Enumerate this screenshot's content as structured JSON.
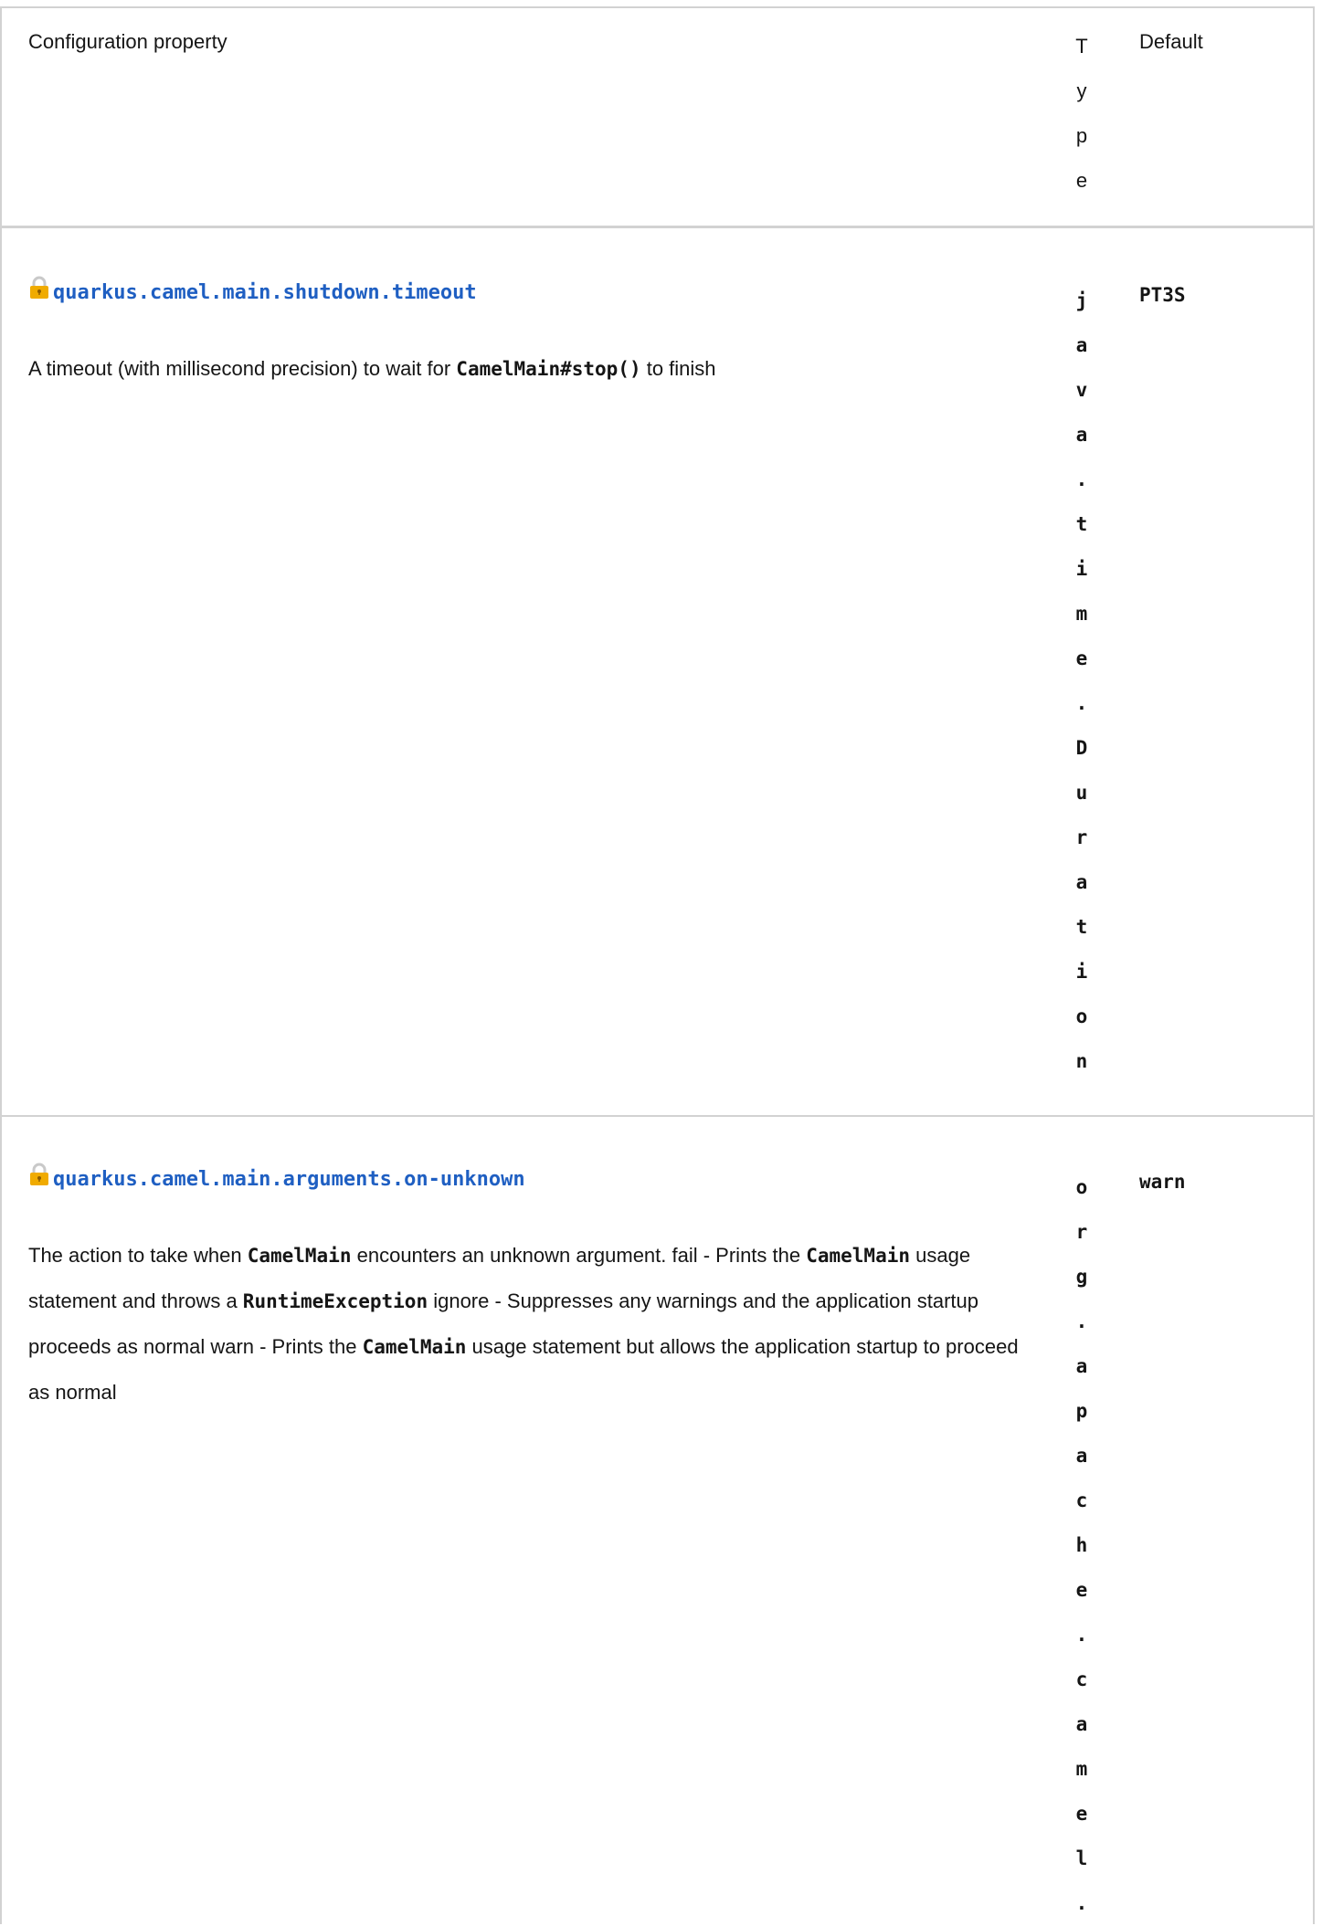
{
  "header": {
    "col_property": "Configuration property",
    "col_type_letters": [
      "T",
      "y",
      "p",
      "e"
    ],
    "col_default": "Default"
  },
  "rows": [
    {
      "name": "quarkus.camel.main.shutdown.timeout",
      "desc": {
        "t1": "A timeout (with millisecond precision) to wait for ",
        "c1": "CamelMain#stop()",
        "t2": " to finish"
      },
      "type_letters": [
        "j",
        "a",
        "v",
        "a",
        ".",
        "t",
        "i",
        "m",
        "e",
        ".",
        "D",
        "u",
        "r",
        "a",
        "t",
        "i",
        "o",
        "n"
      ],
      "default": "PT3S",
      "icon": "lock-icon"
    },
    {
      "name": "quarkus.camel.main.arguments.on-unknown",
      "desc": {
        "t1": "The action to take when ",
        "c1": "CamelMain",
        "t2": " encounters an unknown argument. fail - Prints the ",
        "c2": "CamelMain",
        "t3": " usage statement and throws a ",
        "c3": "RuntimeException",
        "t4": " ignore - Suppresses any warnings and the application startup proceeds as normal warn - Prints the ",
        "c4": "CamelMain",
        "t5": " usage statement but allows the application startup to proceed as normal"
      },
      "type_letters": [
        "o",
        "r",
        "g",
        ".",
        "a",
        "p",
        "a",
        "c",
        "h",
        "e",
        ".",
        "c",
        "a",
        "m",
        "e",
        "l",
        "."
      ],
      "default": "warn",
      "icon": "lock-icon"
    }
  ],
  "colors": {
    "link": "#1f5fc2",
    "border": "#d2d2d2",
    "lock": "#f0ab00"
  }
}
